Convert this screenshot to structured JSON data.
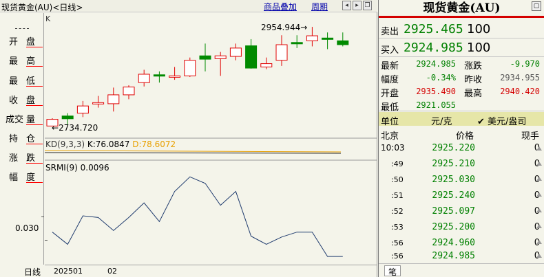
{
  "chart": {
    "title": "现货黄金(AU)<日线>",
    "overlay_button": "商品叠加",
    "period_button": "周期",
    "k_label": "K",
    "tabs": [
      {
        "c1": "开",
        "c2": "盘"
      },
      {
        "c1": "最",
        "c2": "高"
      },
      {
        "c1": "最",
        "c2": "低"
      },
      {
        "c1": "收",
        "c2": "盘"
      },
      {
        "c1": "成交",
        "c2": "量"
      },
      {
        "c1": "持",
        "c2": "仓"
      },
      {
        "c1": "涨",
        "c2": "跌"
      },
      {
        "c1": "幅",
        "c2": "度"
      }
    ],
    "bottom_label": "日线",
    "x_labels": [
      "202501",
      "02"
    ],
    "kd_label_prefix": "KD(9,3,3) ",
    "kd_k": "K:76.0847",
    "kd_d": "D:78.6072",
    "srmi_label": "SRMI(9) 0.0096",
    "srmi_ytick": "0.030",
    "ann_high": "2954.944",
    "ann_low": "2734.720"
  },
  "chart_data": {
    "type": "candlestick",
    "title": "现货黄金(AU)<日线>",
    "candles": [
      {
        "o": 2734,
        "h": 2736,
        "l": 2730,
        "c": 2722,
        "color": "red"
      },
      {
        "o": 2740,
        "h": 2745,
        "l": 2725,
        "c": 2735,
        "color": "green"
      },
      {
        "o": 2745,
        "h": 2767,
        "l": 2738,
        "c": 2758,
        "color": "red"
      },
      {
        "o": 2762,
        "h": 2776,
        "l": 2755,
        "c": 2764,
        "color": "red"
      },
      {
        "o": 2762,
        "h": 2791,
        "l": 2748,
        "c": 2778,
        "color": "red"
      },
      {
        "o": 2778,
        "h": 2795,
        "l": 2770,
        "c": 2792,
        "color": "red"
      },
      {
        "o": 2800,
        "h": 2823,
        "l": 2793,
        "c": 2815,
        "color": "red"
      },
      {
        "o": 2814,
        "h": 2820,
        "l": 2800,
        "c": 2812,
        "color": "green"
      },
      {
        "o": 2810,
        "h": 2828,
        "l": 2805,
        "c": 2812,
        "color": "red"
      },
      {
        "o": 2812,
        "h": 2845,
        "l": 2810,
        "c": 2840,
        "color": "red"
      },
      {
        "o": 2848,
        "h": 2870,
        "l": 2820,
        "c": 2842,
        "color": "green"
      },
      {
        "o": 2843,
        "h": 2855,
        "l": 2812,
        "c": 2848,
        "color": "red"
      },
      {
        "o": 2847,
        "h": 2870,
        "l": 2840,
        "c": 2862,
        "color": "red"
      },
      {
        "o": 2866,
        "h": 2878,
        "l": 2825,
        "c": 2826,
        "color": "green"
      },
      {
        "o": 2828,
        "h": 2845,
        "l": 2824,
        "c": 2834,
        "color": "red"
      },
      {
        "o": 2840,
        "h": 2885,
        "l": 2830,
        "c": 2868,
        "color": "red"
      },
      {
        "o": 2870,
        "h": 2885,
        "l": 2862,
        "c": 2872,
        "color": "green"
      },
      {
        "o": 2875,
        "h": 2900,
        "l": 2865,
        "c": 2884,
        "color": "red"
      },
      {
        "o": 2880,
        "h": 2890,
        "l": 2860,
        "c": 2878,
        "color": "green"
      },
      {
        "o": 2875,
        "h": 2890,
        "l": 2865,
        "c": 2868,
        "color": "green"
      }
    ],
    "price_range": [
      2715,
      2910
    ],
    "srmi": [
      0.04,
      0.025,
      0.06,
      0.058,
      0.042,
      0.058,
      0.076,
      0.053,
      0.09,
      0.108,
      0.1,
      0.073,
      0.09,
      0.035,
      0.025,
      0.034,
      0.04,
      0.04,
      0.01,
      0.01
    ],
    "srmi_range": [
      0.0,
      0.115
    ],
    "srmi_ytick": 0.03
  },
  "quote": {
    "title": "现货黄金(AU)",
    "sell_label": "卖出",
    "sell_price": "2925.465",
    "sell_vol": "100",
    "buy_label": "买入",
    "buy_price": "2924.985",
    "buy_vol": "100",
    "stats": {
      "latest_label": "最新",
      "latest": "2924.985",
      "change_label": "涨跌",
      "change": "-9.970",
      "pct_label": "幅度",
      "pct": "-0.34%",
      "prev_label": "昨收",
      "prev": "2934.955",
      "open_label": "开盘",
      "open": "2935.490",
      "high_label": "最高",
      "high": "2940.420",
      "low_label": "最低",
      "low": "2921.055"
    },
    "unit_label": "单位",
    "unit_value": "元/克",
    "unit_option": "✔ 美元/盎司",
    "tick_header": {
      "time": "北京",
      "price": "价格",
      "vol": "现手"
    },
    "ticks": [
      {
        "time": "10:03",
        "price": "2925.220",
        "vol": "0"
      },
      {
        "time": ":49",
        "price": "2925.210",
        "vol": "0"
      },
      {
        "time": ":50",
        "price": "2925.030",
        "vol": "0"
      },
      {
        "time": ":51",
        "price": "2925.240",
        "vol": "0"
      },
      {
        "time": ":52",
        "price": "2925.097",
        "vol": "0"
      },
      {
        "time": ":53",
        "price": "2925.200",
        "vol": "0"
      },
      {
        "time": ":56",
        "price": "2924.960",
        "vol": "0"
      },
      {
        "time": ":56",
        "price": "2924.985",
        "vol": "0"
      }
    ],
    "bottom_tab": "笔"
  }
}
